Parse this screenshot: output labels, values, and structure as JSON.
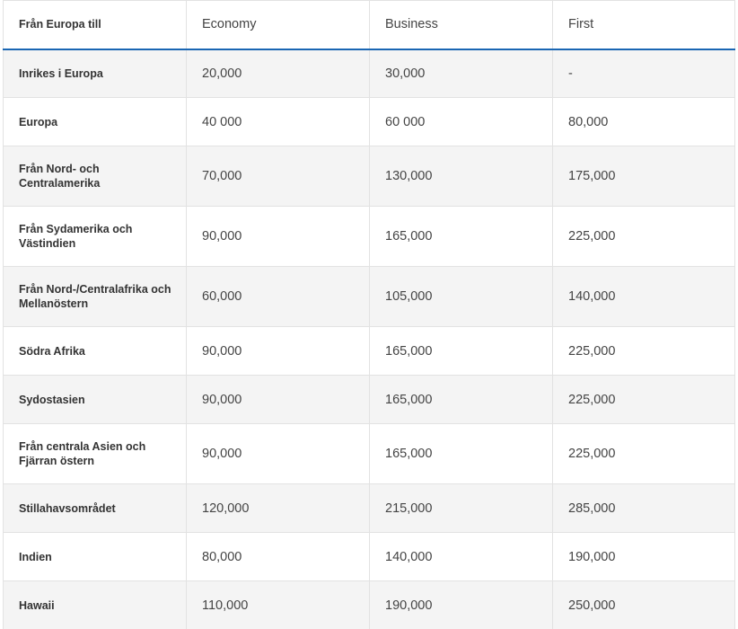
{
  "table": {
    "headers": [
      "Från Europa till",
      "Economy",
      "Business",
      "First"
    ],
    "rows": [
      {
        "region": "Inrikes i Europa",
        "economy": "20,000",
        "business": "30,000",
        "first": "-"
      },
      {
        "region": "Europa",
        "economy": "40 000",
        "business": "60 000",
        "first": "80,000"
      },
      {
        "region": "Från Nord- och Centralamerika",
        "economy": "70,000",
        "business": "130,000",
        "first": "175,000"
      },
      {
        "region": "Från Sydamerika och Västindien",
        "economy": "90,000",
        "business": "165,000",
        "first": "225,000"
      },
      {
        "region": "Från Nord-/Centralafrika och Mellanöstern",
        "economy": "60,000",
        "business": "105,000",
        "first": "140,000"
      },
      {
        "region": "Södra Afrika",
        "economy": "90,000",
        "business": "165,000",
        "first": "225,000"
      },
      {
        "region": "Sydostasien",
        "economy": "90,000",
        "business": "165,000",
        "first": "225,000"
      },
      {
        "region": "Från centrala Asien och Fjärran östern",
        "economy": "90,000",
        "business": "165,000",
        "first": "225,000"
      },
      {
        "region": "Stillahavsområdet",
        "economy": "120,000",
        "business": "215,000",
        "first": "285,000"
      },
      {
        "region": "Indien",
        "economy": "80,000",
        "business": "140,000",
        "first": "190,000"
      },
      {
        "region": "Hawaii",
        "economy": "110,000",
        "business": "190,000",
        "first": "250,000"
      }
    ]
  }
}
